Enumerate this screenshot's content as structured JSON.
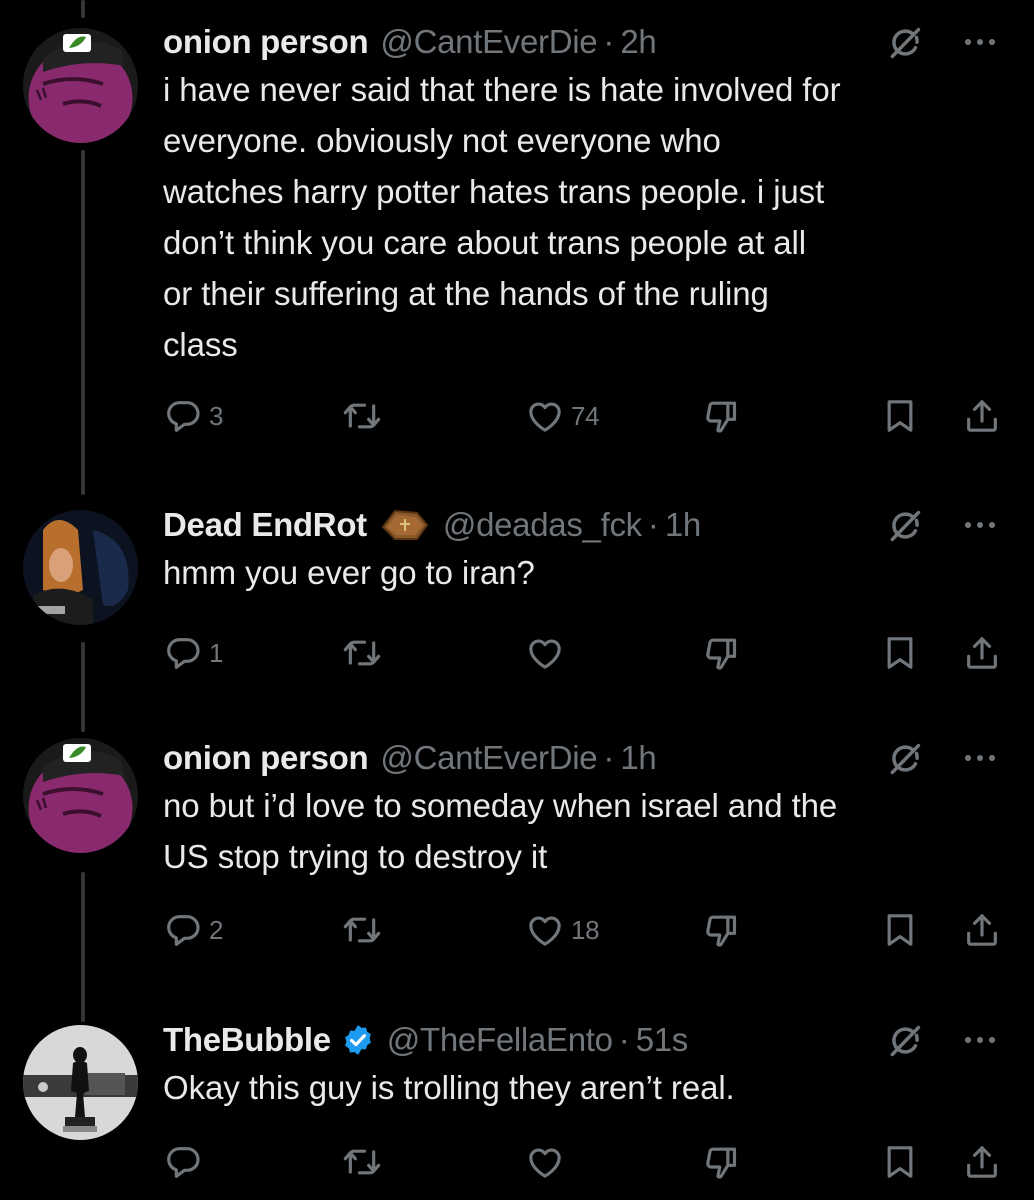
{
  "tweets": [
    {
      "name": "onion person",
      "handle": "@CantEverDie",
      "time": "2h",
      "text": "i have never said that there is hate involved for\neveryone.  obviously not everyone who\nwatches harry potter hates trans people.  i just\ndon’t think you care about trans people at all\nor their suffering at the hands of the ruling\nclass",
      "replies": "3",
      "retweets": "",
      "likes": "74"
    },
    {
      "name": "Dead EndRot",
      "name_emoji": "coffin-emoji",
      "handle": "@deadas_fck",
      "time": "1h",
      "text": "hmm you ever go to iran?",
      "replies": "1",
      "retweets": "",
      "likes": ""
    },
    {
      "name": "onion person",
      "handle": "@CantEverDie",
      "time": "1h",
      "text": "no but i’d love to someday when israel and the\nUS stop trying to destroy it",
      "replies": "2",
      "retweets": "",
      "likes": "18"
    },
    {
      "name": "TheBubble",
      "verified": true,
      "handle": "@TheFellaEnto",
      "time": "51s",
      "text": "Okay this guy is trolling they aren’t real.",
      "replies": "",
      "retweets": "",
      "likes": ""
    }
  ],
  "separator": "·",
  "icons": {
    "reply": "reply-icon",
    "retweet": "retweet-icon",
    "like": "heart-icon",
    "downvote": "downvote-icon",
    "bookmark": "bookmark-icon",
    "share": "share-icon",
    "grok": "grok-icon",
    "more": "more-icon",
    "verified": "verified-badge-icon"
  },
  "colors": {
    "background": "#000000",
    "text": "#e7e9ea",
    "secondary": "#71767b",
    "thread_line": "#333639",
    "verified": "#1d9bf0",
    "avatar_purple": "#8a2a6e"
  }
}
